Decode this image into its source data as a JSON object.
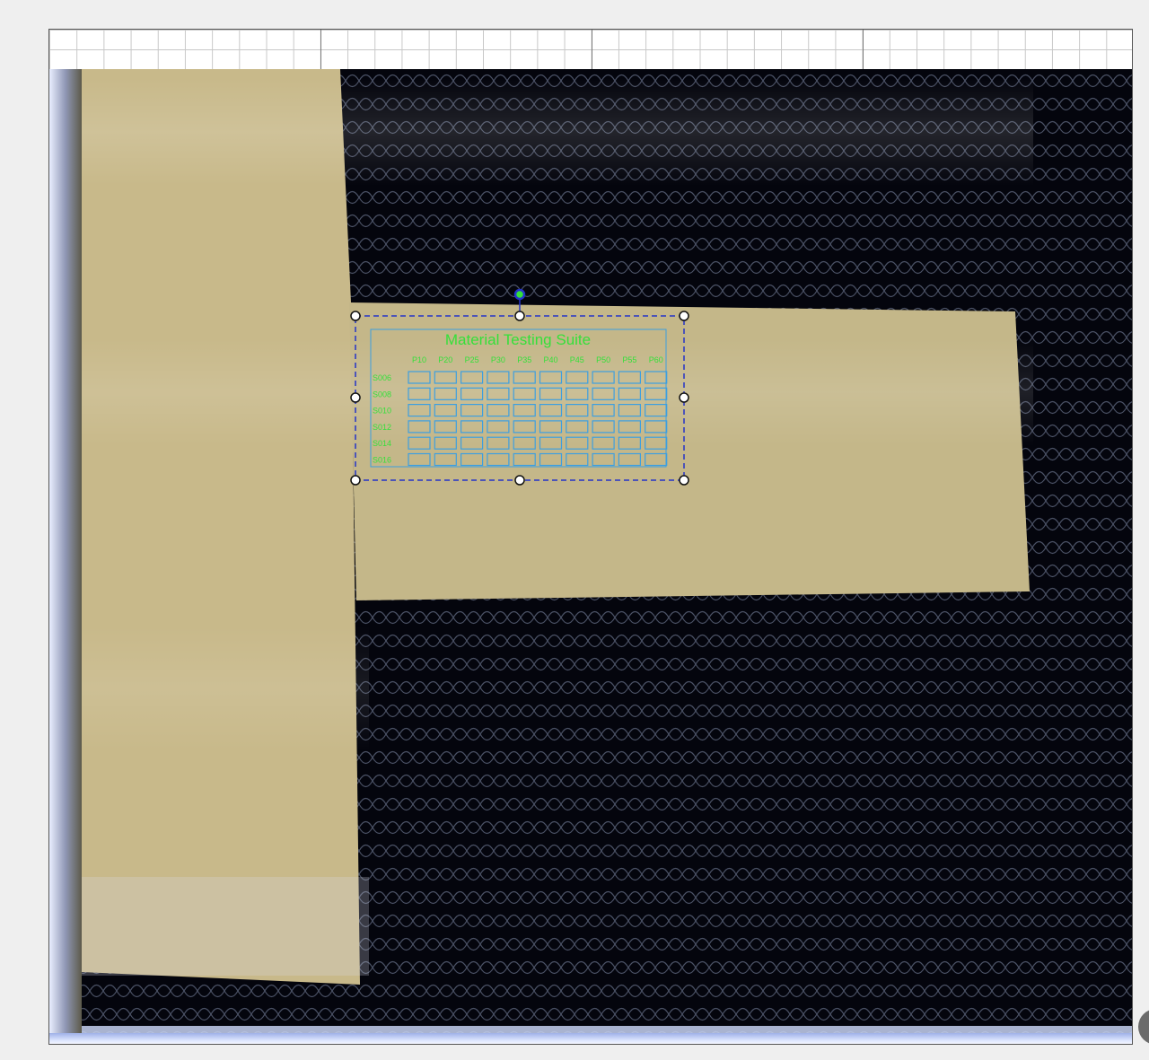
{
  "canvas": {
    "colors": {
      "background": "#efefef",
      "bed": "#04050d",
      "material": "#c8b98a",
      "honeycomb": "#4b5266",
      "grid_stroke": "#3d9fe0",
      "label_text": "#35e03a",
      "selection": "#2433c8"
    }
  },
  "design": {
    "title": "Material Testing Suite",
    "power_labels": [
      "P10",
      "P20",
      "P25",
      "P30",
      "P35",
      "P40",
      "P45",
      "P50",
      "P55",
      "P60"
    ],
    "speed_labels": [
      "S006",
      "S008",
      "S010",
      "S012",
      "S014",
      "S016"
    ]
  },
  "icons": {
    "rotate_handle": "rotate-handle-icon",
    "resize_handle": "resize-handle-icon"
  }
}
